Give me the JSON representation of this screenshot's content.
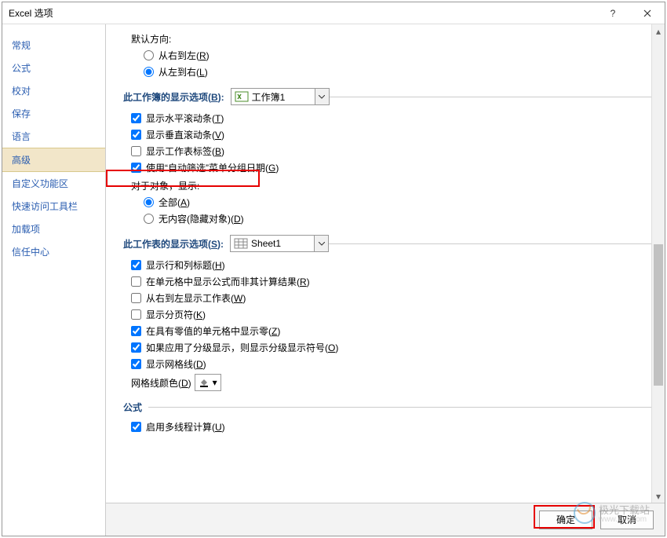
{
  "title": "Excel 选项",
  "sidebar": {
    "items": [
      {
        "label": "常规"
      },
      {
        "label": "公式"
      },
      {
        "label": "校对"
      },
      {
        "label": "保存"
      },
      {
        "label": "语言"
      },
      {
        "label": "高级",
        "active": true
      },
      {
        "label": "自定义功能区"
      },
      {
        "label": "快速访问工具栏"
      },
      {
        "label": "加载项"
      },
      {
        "label": "信任中心"
      }
    ]
  },
  "defaultDirection": {
    "label": "默认方向:",
    "opt1": "从右到左(R)",
    "opt2": "从左到右(L)"
  },
  "workbookSection": {
    "title": "此工作簿的显示选项(B):",
    "combo": "工作簿1",
    "c1": "显示水平滚动条(T)",
    "c2": "显示垂直滚动条(V)",
    "c3": "显示工作表标签(B)",
    "c4": "使用\"自动筛选\"菜单分组日期(G)",
    "objLabel": "对于对象，显示:",
    "r1": "全部(A)",
    "r2": "无内容(隐藏对象)(D)"
  },
  "sheetSection": {
    "title": "此工作表的显示选项(S):",
    "combo": "Sheet1",
    "c1": "显示行和列标题(H)",
    "c2": "在单元格中显示公式而非其计算结果(R)",
    "c3": "从右到左显示工作表(W)",
    "c4": "显示分页符(K)",
    "c5": "在具有零值的单元格中显示零(Z)",
    "c6": "如果应用了分级显示，则显示分级显示符号(O)",
    "c7": "显示网格线(D)",
    "gridColor": "网格线颜色(D)"
  },
  "formulaSection": {
    "title": "公式",
    "c1": "启用多线程计算(U)"
  },
  "footer": {
    "ok": "确定",
    "cancel": "取消"
  },
  "watermark": {
    "t1": "极光下载站",
    "t2": "www.xz7.com"
  }
}
